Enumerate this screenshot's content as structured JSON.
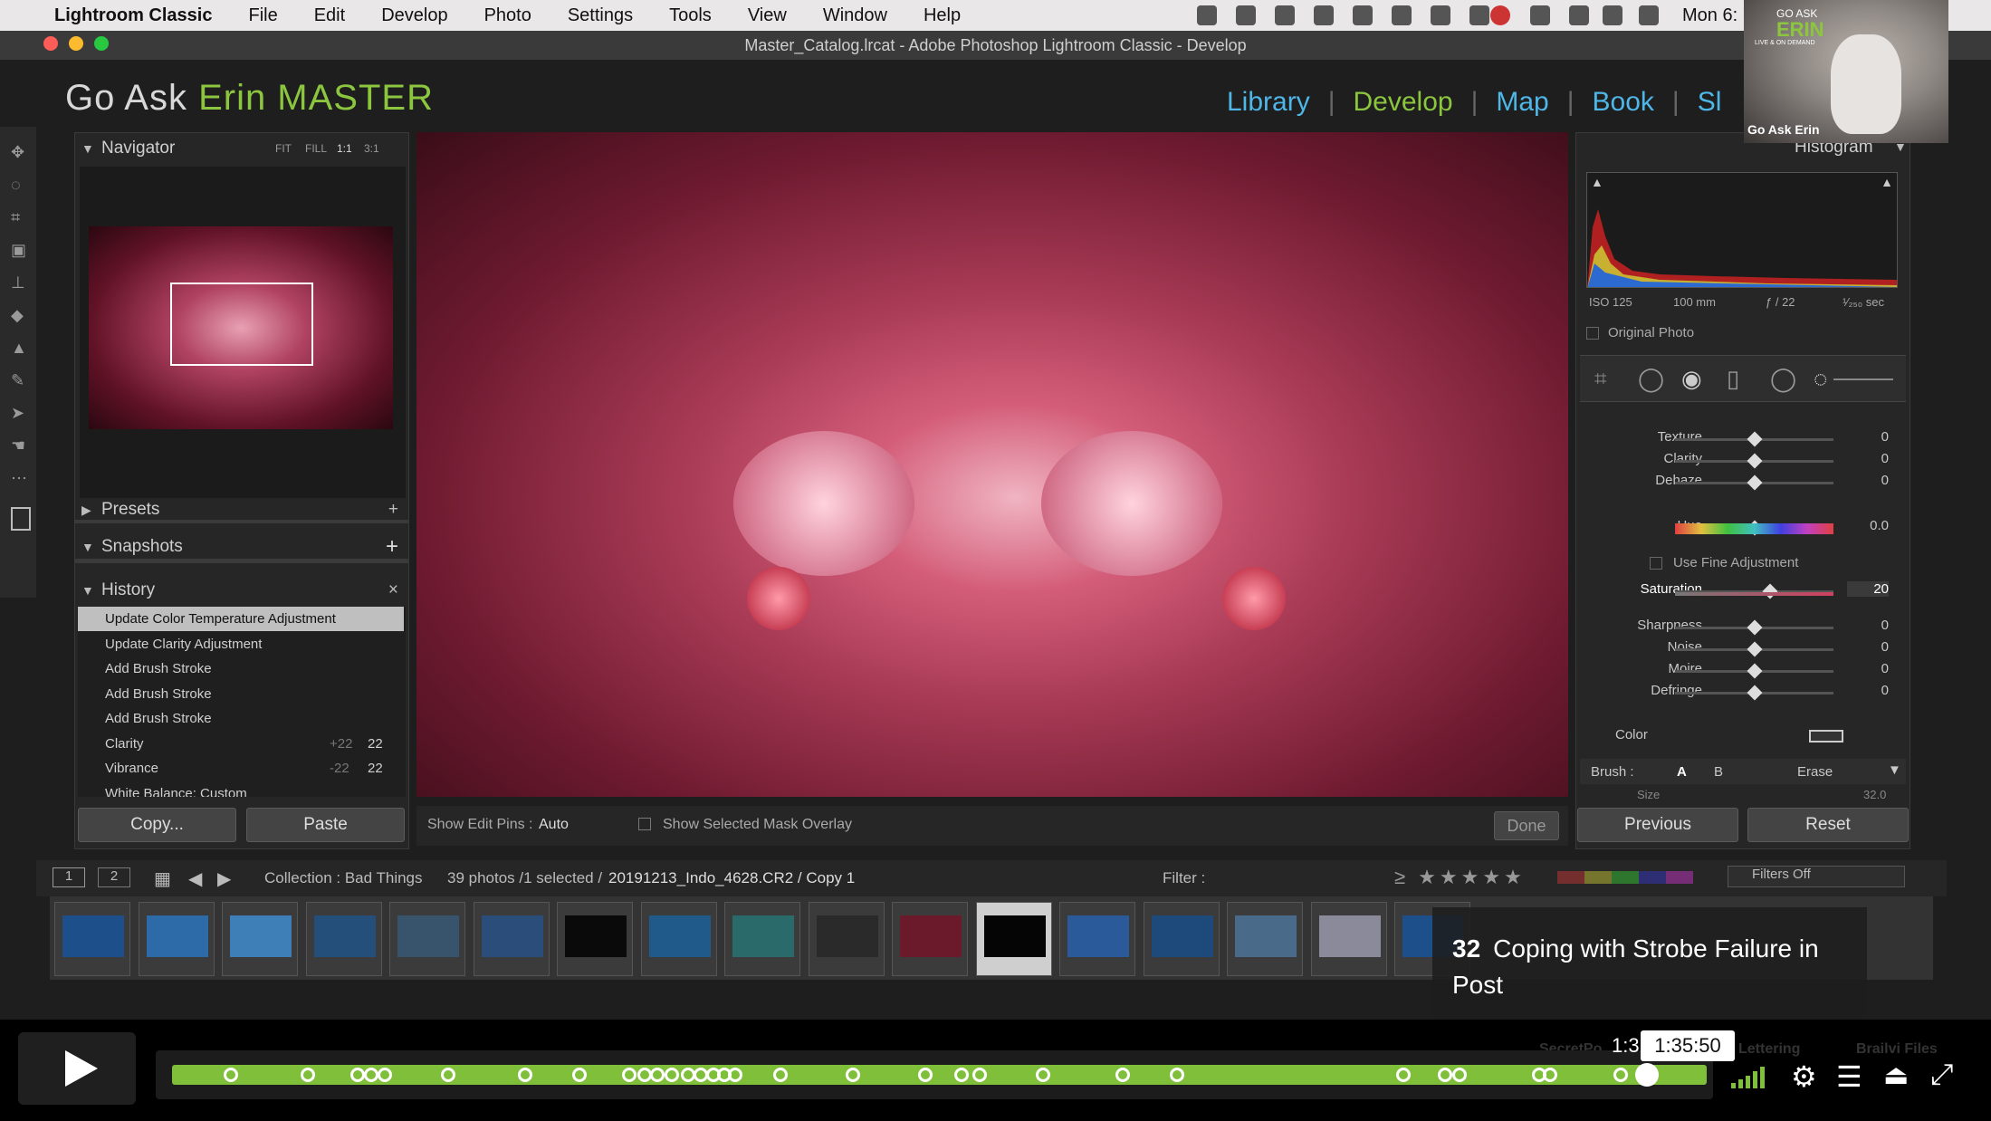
{
  "menubar": {
    "app": "Lightroom Classic",
    "items": [
      "File",
      "Edit",
      "Develop",
      "Photo",
      "Settings",
      "Tools",
      "View",
      "Window",
      "Help"
    ],
    "clock": "Mon 6:"
  },
  "window": {
    "title": "Master_Catalog.lrcat - Adobe Photoshop Lightroom Classic - Develop"
  },
  "identity": {
    "plain": "Go Ask ",
    "accent": "Erin MASTER"
  },
  "modules": [
    "Library",
    "Develop",
    "Map",
    "Book",
    "Sl"
  ],
  "left": {
    "navigator": "Navigator",
    "nav_opts": [
      "FIT",
      "FILL",
      "1:1",
      "3:1"
    ],
    "presets": "Presets",
    "snapshots": "Snapshots",
    "history": "History",
    "history_items": [
      {
        "label": "Update Color Temperature Adjustment",
        "a": "",
        "b": ""
      },
      {
        "label": "Update Clarity Adjustment",
        "a": "",
        "b": ""
      },
      {
        "label": "Add Brush Stroke",
        "a": "",
        "b": ""
      },
      {
        "label": "Add Brush Stroke",
        "a": "",
        "b": ""
      },
      {
        "label": "Add Brush Stroke",
        "a": "",
        "b": ""
      },
      {
        "label": "Clarity",
        "a": "+22",
        "b": "22"
      },
      {
        "label": "Vibrance",
        "a": "-22",
        "b": "22"
      },
      {
        "label": "White Balance: Custom",
        "a": "",
        "b": ""
      }
    ],
    "copy": "Copy...",
    "paste": "Paste"
  },
  "toolbar": {
    "pins_label": "Show Edit Pins :",
    "pins_value": "Auto",
    "mask_label": "Show Selected Mask Overlay",
    "done": "Done"
  },
  "right": {
    "histogram": "Histogram",
    "exif": [
      "ISO 125",
      "100 mm",
      "ƒ / 22",
      "¹⁄₂₅₀ sec"
    ],
    "original": "Original Photo",
    "sliders": [
      {
        "label": "Texture",
        "value": "0",
        "pos": 0.5
      },
      {
        "label": "Clarity",
        "value": "0",
        "pos": 0.5
      },
      {
        "label": "Dehaze",
        "value": "0",
        "pos": 0.5
      },
      {
        "label": "Hue",
        "value": "0.0",
        "pos": 0.5
      },
      {
        "label": "Saturation",
        "value": "20",
        "pos": 0.6
      },
      {
        "label": "Sharpness",
        "value": "0",
        "pos": 0.5
      },
      {
        "label": "Noise",
        "value": "0",
        "pos": 0.5
      },
      {
        "label": "Moire",
        "value": "0",
        "pos": 0.5
      },
      {
        "label": "Defringe",
        "value": "0",
        "pos": 0.5
      }
    ],
    "fine": "Use Fine Adjustment",
    "color": "Color",
    "brush": "Brush :",
    "brush_a": "A",
    "brush_b": "B",
    "erase": "Erase",
    "size": "Size",
    "size_value": "32.0",
    "previous": "Previous",
    "reset": "Reset"
  },
  "filmbar": {
    "pages": [
      "1",
      "2"
    ],
    "collection": "Collection : Bad Things",
    "count": "39 photos /1 selected /",
    "file": "20191213_Indo_4628.CR2 / Copy 1",
    "filter": "Filter :",
    "filters_off": "Filters Off"
  },
  "video": {
    "number": "32",
    "title": "Coping with Strobe Failure in Post",
    "time": "1:35:50",
    "time_partial": "1:3",
    "footer_labels": [
      "SecretPo",
      "Lettering",
      "Brailvi Files"
    ]
  },
  "webcam": {
    "brand_top": "GO ASK",
    "brand": "ERIN",
    "brand_sub": "LIVE & ON DEMAND",
    "name": "Go Ask Erin"
  },
  "colors": {
    "accent_green": "#8cc63e",
    "module_blue": "#4fb6e8",
    "progress": "#7fbf3a"
  }
}
